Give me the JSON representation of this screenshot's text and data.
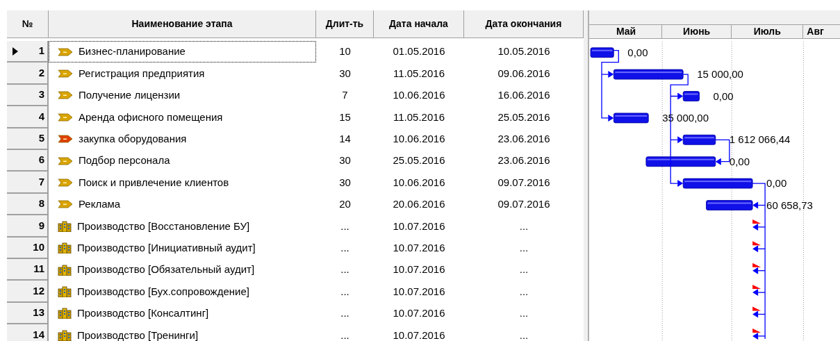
{
  "table": {
    "columns": [
      "№",
      "Наименование этапа",
      "Длит-ть",
      "Дата начала",
      "Дата окончания"
    ],
    "rows": [
      {
        "number": "1",
        "kind": "stage",
        "color": "#d9a400",
        "name": "Бизнес-планирование",
        "duration": "10",
        "start": "01.05.2016",
        "end": "10.05.2016",
        "cost": "0,00",
        "selected": true
      },
      {
        "number": "2",
        "kind": "stage",
        "color": "#d9a400",
        "name": "Регистрация предприятия",
        "duration": "30",
        "start": "11.05.2016",
        "end": "09.06.2016",
        "cost": "15 000,00",
        "selected": false
      },
      {
        "number": "3",
        "kind": "stage",
        "color": "#d9a400",
        "name": "Получение лицензии",
        "duration": "7",
        "start": "10.06.2016",
        "end": "16.06.2016",
        "cost": "0,00",
        "selected": false
      },
      {
        "number": "4",
        "kind": "stage",
        "color": "#d9a400",
        "name": "Аренда офисного помещения",
        "duration": "15",
        "start": "11.05.2016",
        "end": "25.05.2016",
        "cost": "35 000,00",
        "selected": false
      },
      {
        "number": "5",
        "kind": "stage",
        "color": "#e04000",
        "name": "закупка оборудования",
        "duration": "14",
        "start": "10.06.2016",
        "end": "23.06.2016",
        "cost": "1 612 066,44",
        "selected": false
      },
      {
        "number": "6",
        "kind": "stage",
        "color": "#d9a400",
        "name": "Подбор персонала",
        "duration": "30",
        "start": "25.05.2016",
        "end": "23.06.2016",
        "cost": "0,00",
        "selected": false
      },
      {
        "number": "7",
        "kind": "stage",
        "color": "#d9a400",
        "name": "Поиск и привлечение клиентов",
        "duration": "30",
        "start": "10.06.2016",
        "end": "09.07.2016",
        "cost": "0,00",
        "selected": false
      },
      {
        "number": "8",
        "kind": "stage",
        "color": "#d9a400",
        "name": "Реклама",
        "duration": "20",
        "start": "20.06.2016",
        "end": "09.07.2016",
        "cost": "60 658,73",
        "selected": false
      },
      {
        "number": "9",
        "kind": "production",
        "name": "Производство [Восстановление БУ]",
        "duration": "...",
        "start": "10.07.2016",
        "end": "...",
        "selected": false
      },
      {
        "number": "10",
        "kind": "production",
        "name": "Производство [Инициативный аудит]",
        "duration": "...",
        "start": "10.07.2016",
        "end": "...",
        "selected": false
      },
      {
        "number": "11",
        "kind": "production",
        "name": "Производство [Обязательный аудит]",
        "duration": "...",
        "start": "10.07.2016",
        "end": "...",
        "selected": false
      },
      {
        "number": "12",
        "kind": "production",
        "name": "Производство [Бух.сопровождение]",
        "duration": "...",
        "start": "10.07.2016",
        "end": "...",
        "selected": false
      },
      {
        "number": "13",
        "kind": "production",
        "name": "Производство [Консалтинг]",
        "duration": "...",
        "start": "10.07.2016",
        "end": "...",
        "selected": false
      },
      {
        "number": "14",
        "kind": "production",
        "name": "Производство [Тренинги]",
        "duration": "...",
        "start": "10.07.2016",
        "end": "...",
        "selected": false
      }
    ]
  },
  "gantt": {
    "months": [
      "Май",
      "Июнь",
      "Июль",
      "Авг"
    ]
  }
}
